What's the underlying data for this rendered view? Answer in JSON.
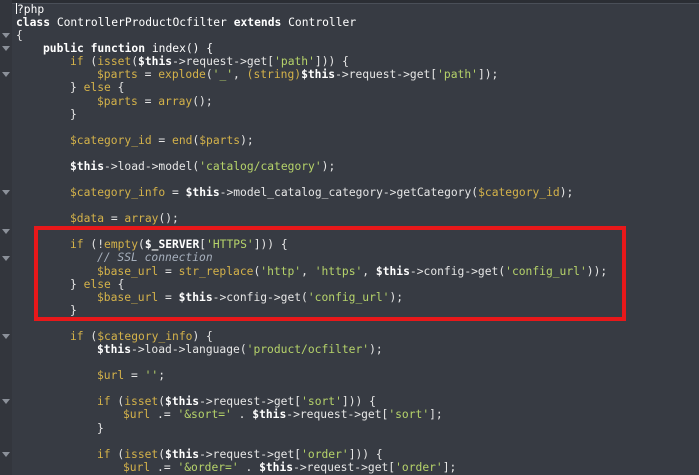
{
  "editor": {
    "language": "php",
    "highlight_color": "#e8181a",
    "background_color": "#373b43"
  },
  "fold_markers": [
    2,
    3,
    5,
    14,
    17,
    19,
    25,
    30,
    34
  ],
  "lines": [
    {
      "indent": 0,
      "tokens": [
        {
          "t": "cursor"
        },
        {
          "t": "tag",
          "v": "?php"
        }
      ]
    },
    {
      "indent": 0,
      "tokens": [
        {
          "t": "kw",
          "v": "class"
        },
        {
          "t": "sp"
        },
        {
          "t": "cls",
          "v": "ControllerProductOcfilter"
        },
        {
          "t": "sp"
        },
        {
          "t": "kw",
          "v": "extends"
        },
        {
          "t": "sp"
        },
        {
          "t": "cls",
          "v": "Controller"
        }
      ]
    },
    {
      "indent": 0,
      "tokens": [
        {
          "t": "op",
          "v": "{"
        }
      ]
    },
    {
      "indent": 1,
      "tokens": [
        {
          "t": "kw",
          "v": "public"
        },
        {
          "t": "sp"
        },
        {
          "t": "kw",
          "v": "function"
        },
        {
          "t": "sp"
        },
        {
          "t": "id",
          "v": "index() {"
        }
      ]
    },
    {
      "indent": 2,
      "tokens": [
        {
          "t": "ctl",
          "v": "if"
        },
        {
          "t": "op",
          "v": " ("
        },
        {
          "t": "fn",
          "v": "isset"
        },
        {
          "t": "op",
          "v": "("
        },
        {
          "t": "thisv",
          "v": "$this"
        },
        {
          "t": "mth",
          "v": "->request->get["
        },
        {
          "t": "str",
          "v": "'path'"
        },
        {
          "t": "op",
          "v": "])) {"
        }
      ]
    },
    {
      "indent": 3,
      "tokens": [
        {
          "t": "var",
          "v": "$parts"
        },
        {
          "t": "op",
          "v": " = "
        },
        {
          "t": "fn",
          "v": "explode"
        },
        {
          "t": "op",
          "v": "("
        },
        {
          "t": "str",
          "v": "'_'"
        },
        {
          "t": "op",
          "v": ", "
        },
        {
          "t": "fn",
          "v": "(string)"
        },
        {
          "t": "thisv",
          "v": "$this"
        },
        {
          "t": "mth",
          "v": "->request->get["
        },
        {
          "t": "str",
          "v": "'path'"
        },
        {
          "t": "op",
          "v": "]);"
        }
      ]
    },
    {
      "indent": 2,
      "tokens": [
        {
          "t": "op",
          "v": "} "
        },
        {
          "t": "ctl",
          "v": "else"
        },
        {
          "t": "op",
          "v": " {"
        }
      ]
    },
    {
      "indent": 3,
      "tokens": [
        {
          "t": "var",
          "v": "$parts"
        },
        {
          "t": "op",
          "v": " = "
        },
        {
          "t": "fn",
          "v": "array"
        },
        {
          "t": "op",
          "v": "();"
        }
      ]
    },
    {
      "indent": 2,
      "tokens": [
        {
          "t": "op",
          "v": "}"
        }
      ]
    },
    {
      "indent": 0,
      "tokens": []
    },
    {
      "indent": 2,
      "tokens": [
        {
          "t": "var",
          "v": "$category_id"
        },
        {
          "t": "op",
          "v": " = "
        },
        {
          "t": "fn",
          "v": "end"
        },
        {
          "t": "op",
          "v": "("
        },
        {
          "t": "var",
          "v": "$parts"
        },
        {
          "t": "op",
          "v": ");"
        }
      ]
    },
    {
      "indent": 0,
      "tokens": []
    },
    {
      "indent": 2,
      "tokens": [
        {
          "t": "thisv",
          "v": "$this"
        },
        {
          "t": "mth",
          "v": "->load->model("
        },
        {
          "t": "str",
          "v": "'catalog/category'"
        },
        {
          "t": "op",
          "v": ");"
        }
      ]
    },
    {
      "indent": 0,
      "tokens": []
    },
    {
      "indent": 2,
      "tokens": [
        {
          "t": "var",
          "v": "$category_info"
        },
        {
          "t": "op",
          "v": " = "
        },
        {
          "t": "thisv",
          "v": "$this"
        },
        {
          "t": "mth",
          "v": "->model_catalog_category->getCategory("
        },
        {
          "t": "var",
          "v": "$category_id"
        },
        {
          "t": "op",
          "v": ");"
        }
      ]
    },
    {
      "indent": 0,
      "tokens": []
    },
    {
      "indent": 2,
      "tokens": [
        {
          "t": "var",
          "v": "$data"
        },
        {
          "t": "op",
          "v": " = "
        },
        {
          "t": "fn",
          "v": "array"
        },
        {
          "t": "op",
          "v": "();"
        }
      ]
    },
    {
      "indent": 0,
      "tokens": []
    },
    {
      "indent": 2,
      "tokens": [
        {
          "t": "ctl",
          "v": "if"
        },
        {
          "t": "op",
          "v": " (!"
        },
        {
          "t": "fn",
          "v": "empty"
        },
        {
          "t": "op",
          "v": "("
        },
        {
          "t": "sv",
          "v": "$_SERVER"
        },
        {
          "t": "op",
          "v": "["
        },
        {
          "t": "str",
          "v": "'HTTPS'"
        },
        {
          "t": "op",
          "v": "])) {"
        }
      ]
    },
    {
      "indent": 3,
      "tokens": [
        {
          "t": "cmt",
          "v": "// SSL connection"
        }
      ]
    },
    {
      "indent": 3,
      "tokens": [
        {
          "t": "var",
          "v": "$base_url"
        },
        {
          "t": "op",
          "v": " = "
        },
        {
          "t": "fn",
          "v": "str_replace"
        },
        {
          "t": "op",
          "v": "("
        },
        {
          "t": "str",
          "v": "'http'"
        },
        {
          "t": "op",
          "v": ", "
        },
        {
          "t": "str",
          "v": "'https'"
        },
        {
          "t": "op",
          "v": ", "
        },
        {
          "t": "thisv",
          "v": "$this"
        },
        {
          "t": "mth",
          "v": "->config->get("
        },
        {
          "t": "str",
          "v": "'config_url'"
        },
        {
          "t": "op",
          "v": "));"
        }
      ]
    },
    {
      "indent": 2,
      "tokens": [
        {
          "t": "op",
          "v": "} "
        },
        {
          "t": "ctl",
          "v": "else"
        },
        {
          "t": "op",
          "v": " {"
        }
      ]
    },
    {
      "indent": 3,
      "tokens": [
        {
          "t": "var",
          "v": "$base_url"
        },
        {
          "t": "op",
          "v": " = "
        },
        {
          "t": "thisv",
          "v": "$this"
        },
        {
          "t": "mth",
          "v": "->config->get("
        },
        {
          "t": "str",
          "v": "'config_url'"
        },
        {
          "t": "op",
          "v": ");"
        }
      ]
    },
    {
      "indent": 2,
      "tokens": [
        {
          "t": "op",
          "v": "}"
        }
      ]
    },
    {
      "indent": 0,
      "tokens": []
    },
    {
      "indent": 2,
      "tokens": [
        {
          "t": "ctl",
          "v": "if"
        },
        {
          "t": "op",
          "v": " ("
        },
        {
          "t": "var",
          "v": "$category_info"
        },
        {
          "t": "op",
          "v": ") {"
        }
      ]
    },
    {
      "indent": 3,
      "tokens": [
        {
          "t": "thisv",
          "v": "$this"
        },
        {
          "t": "mth",
          "v": "->load->language("
        },
        {
          "t": "str",
          "v": "'product/ocfilter'"
        },
        {
          "t": "op",
          "v": ");"
        }
      ]
    },
    {
      "indent": 0,
      "tokens": []
    },
    {
      "indent": 3,
      "tokens": [
        {
          "t": "var",
          "v": "$url"
        },
        {
          "t": "op",
          "v": " = "
        },
        {
          "t": "str",
          "v": "''"
        },
        {
          "t": "op",
          "v": ";"
        }
      ]
    },
    {
      "indent": 0,
      "tokens": []
    },
    {
      "indent": 3,
      "tokens": [
        {
          "t": "ctl",
          "v": "if"
        },
        {
          "t": "op",
          "v": " ("
        },
        {
          "t": "fn",
          "v": "isset"
        },
        {
          "t": "op",
          "v": "("
        },
        {
          "t": "thisv",
          "v": "$this"
        },
        {
          "t": "mth",
          "v": "->request->get["
        },
        {
          "t": "str",
          "v": "'sort'"
        },
        {
          "t": "op",
          "v": "])) {"
        }
      ]
    },
    {
      "indent": 4,
      "tokens": [
        {
          "t": "var",
          "v": "$url"
        },
        {
          "t": "op",
          "v": " .= "
        },
        {
          "t": "str",
          "v": "'&sort='"
        },
        {
          "t": "op",
          "v": " . "
        },
        {
          "t": "thisv",
          "v": "$this"
        },
        {
          "t": "mth",
          "v": "->request->get["
        },
        {
          "t": "str",
          "v": "'sort'"
        },
        {
          "t": "op",
          "v": "];"
        }
      ]
    },
    {
      "indent": 3,
      "tokens": [
        {
          "t": "op",
          "v": "}"
        }
      ]
    },
    {
      "indent": 0,
      "tokens": []
    },
    {
      "indent": 3,
      "tokens": [
        {
          "t": "ctl",
          "v": "if"
        },
        {
          "t": "op",
          "v": " ("
        },
        {
          "t": "fn",
          "v": "isset"
        },
        {
          "t": "op",
          "v": "("
        },
        {
          "t": "thisv",
          "v": "$this"
        },
        {
          "t": "mth",
          "v": "->request->get["
        },
        {
          "t": "str",
          "v": "'order'"
        },
        {
          "t": "op",
          "v": "])) {"
        }
      ]
    },
    {
      "indent": 4,
      "tokens": [
        {
          "t": "var",
          "v": "$url"
        },
        {
          "t": "op",
          "v": " .= "
        },
        {
          "t": "str",
          "v": "'&order='"
        },
        {
          "t": "op",
          "v": " . "
        },
        {
          "t": "thisv",
          "v": "$this"
        },
        {
          "t": "mth",
          "v": "->request->get["
        },
        {
          "t": "str",
          "v": "'order'"
        },
        {
          "t": "op",
          "v": "];"
        }
      ]
    },
    {
      "indent": 3,
      "tokens": [
        {
          "t": "op",
          "v": "}"
        }
      ]
    }
  ]
}
